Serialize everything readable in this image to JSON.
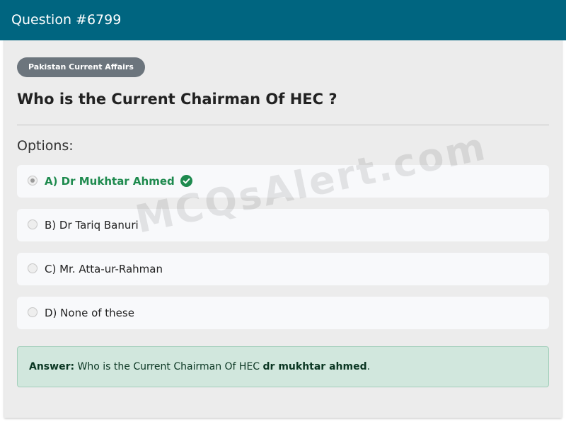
{
  "header": {
    "title": "Question #6799"
  },
  "category": {
    "label": "Pakistan Current Affairs"
  },
  "question": {
    "text": "Who is the Current Chairman Of HEC ?"
  },
  "options_heading": "Options:",
  "options": [
    {
      "label": "A) Dr Mukhtar Ahmed",
      "selected": true,
      "correct": true
    },
    {
      "label": "B) Dr Tariq Banuri",
      "selected": false,
      "correct": false
    },
    {
      "label": "C) Mr. Atta-ur-Rahman",
      "selected": false,
      "correct": false
    },
    {
      "label": "D) None of these",
      "selected": false,
      "correct": false
    }
  ],
  "answer": {
    "prefix": "Answer:",
    "text": "Who is the Current Chairman Of HEC",
    "value": "dr mukhtar ahmed",
    "suffix": "."
  },
  "watermark": "MCQsAlert.com",
  "colors": {
    "header_bg": "#006580",
    "badge_bg": "#6c757d",
    "correct_green": "#1e8a4e",
    "answer_bg": "#d1e7dd"
  }
}
